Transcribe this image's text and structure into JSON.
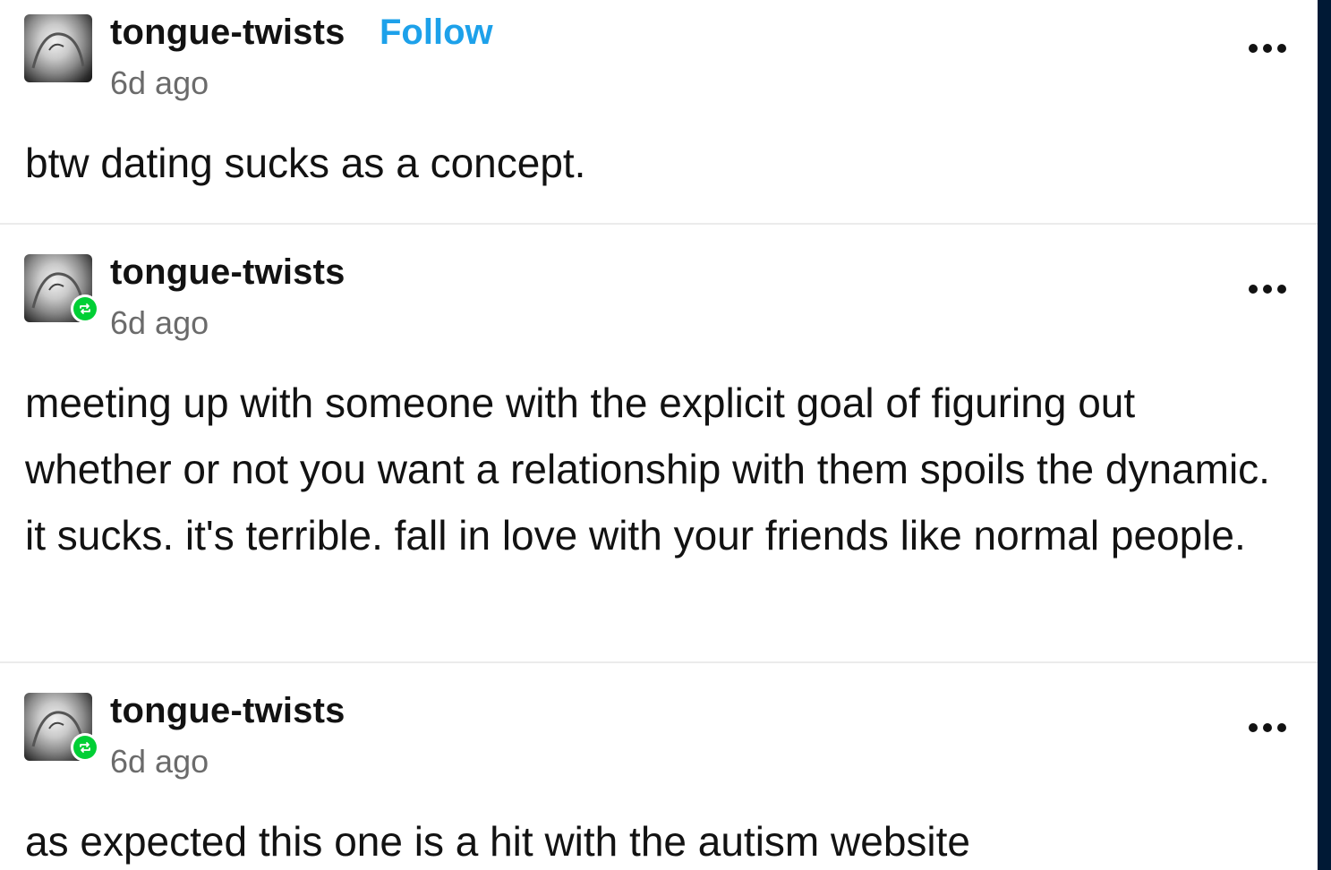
{
  "posts": [
    {
      "username": "tongue-twists",
      "follow_label": "Follow",
      "timestamp": "6d ago",
      "reblogged": false,
      "text": "btw dating sucks as a concept."
    },
    {
      "username": "tongue-twists",
      "timestamp": "6d ago",
      "reblogged": true,
      "text": "meeting up with someone with the explicit goal of figuring out whether or not you want a relationship with them spoils the dynamic. it sucks. it's terrible. fall in love with your friends like normal people."
    },
    {
      "username": "tongue-twists",
      "timestamp": "6d ago",
      "reblogged": true,
      "text": "as expected this one is a hit with the autism website"
    }
  ],
  "colors": {
    "follow": "#1da1ea",
    "reblog_badge": "#00cf35",
    "timestamp": "#6b6b6b",
    "edge_bar": "#001935"
  },
  "icons": {
    "more": "more-options-icon",
    "reblog": "reblog-icon"
  }
}
